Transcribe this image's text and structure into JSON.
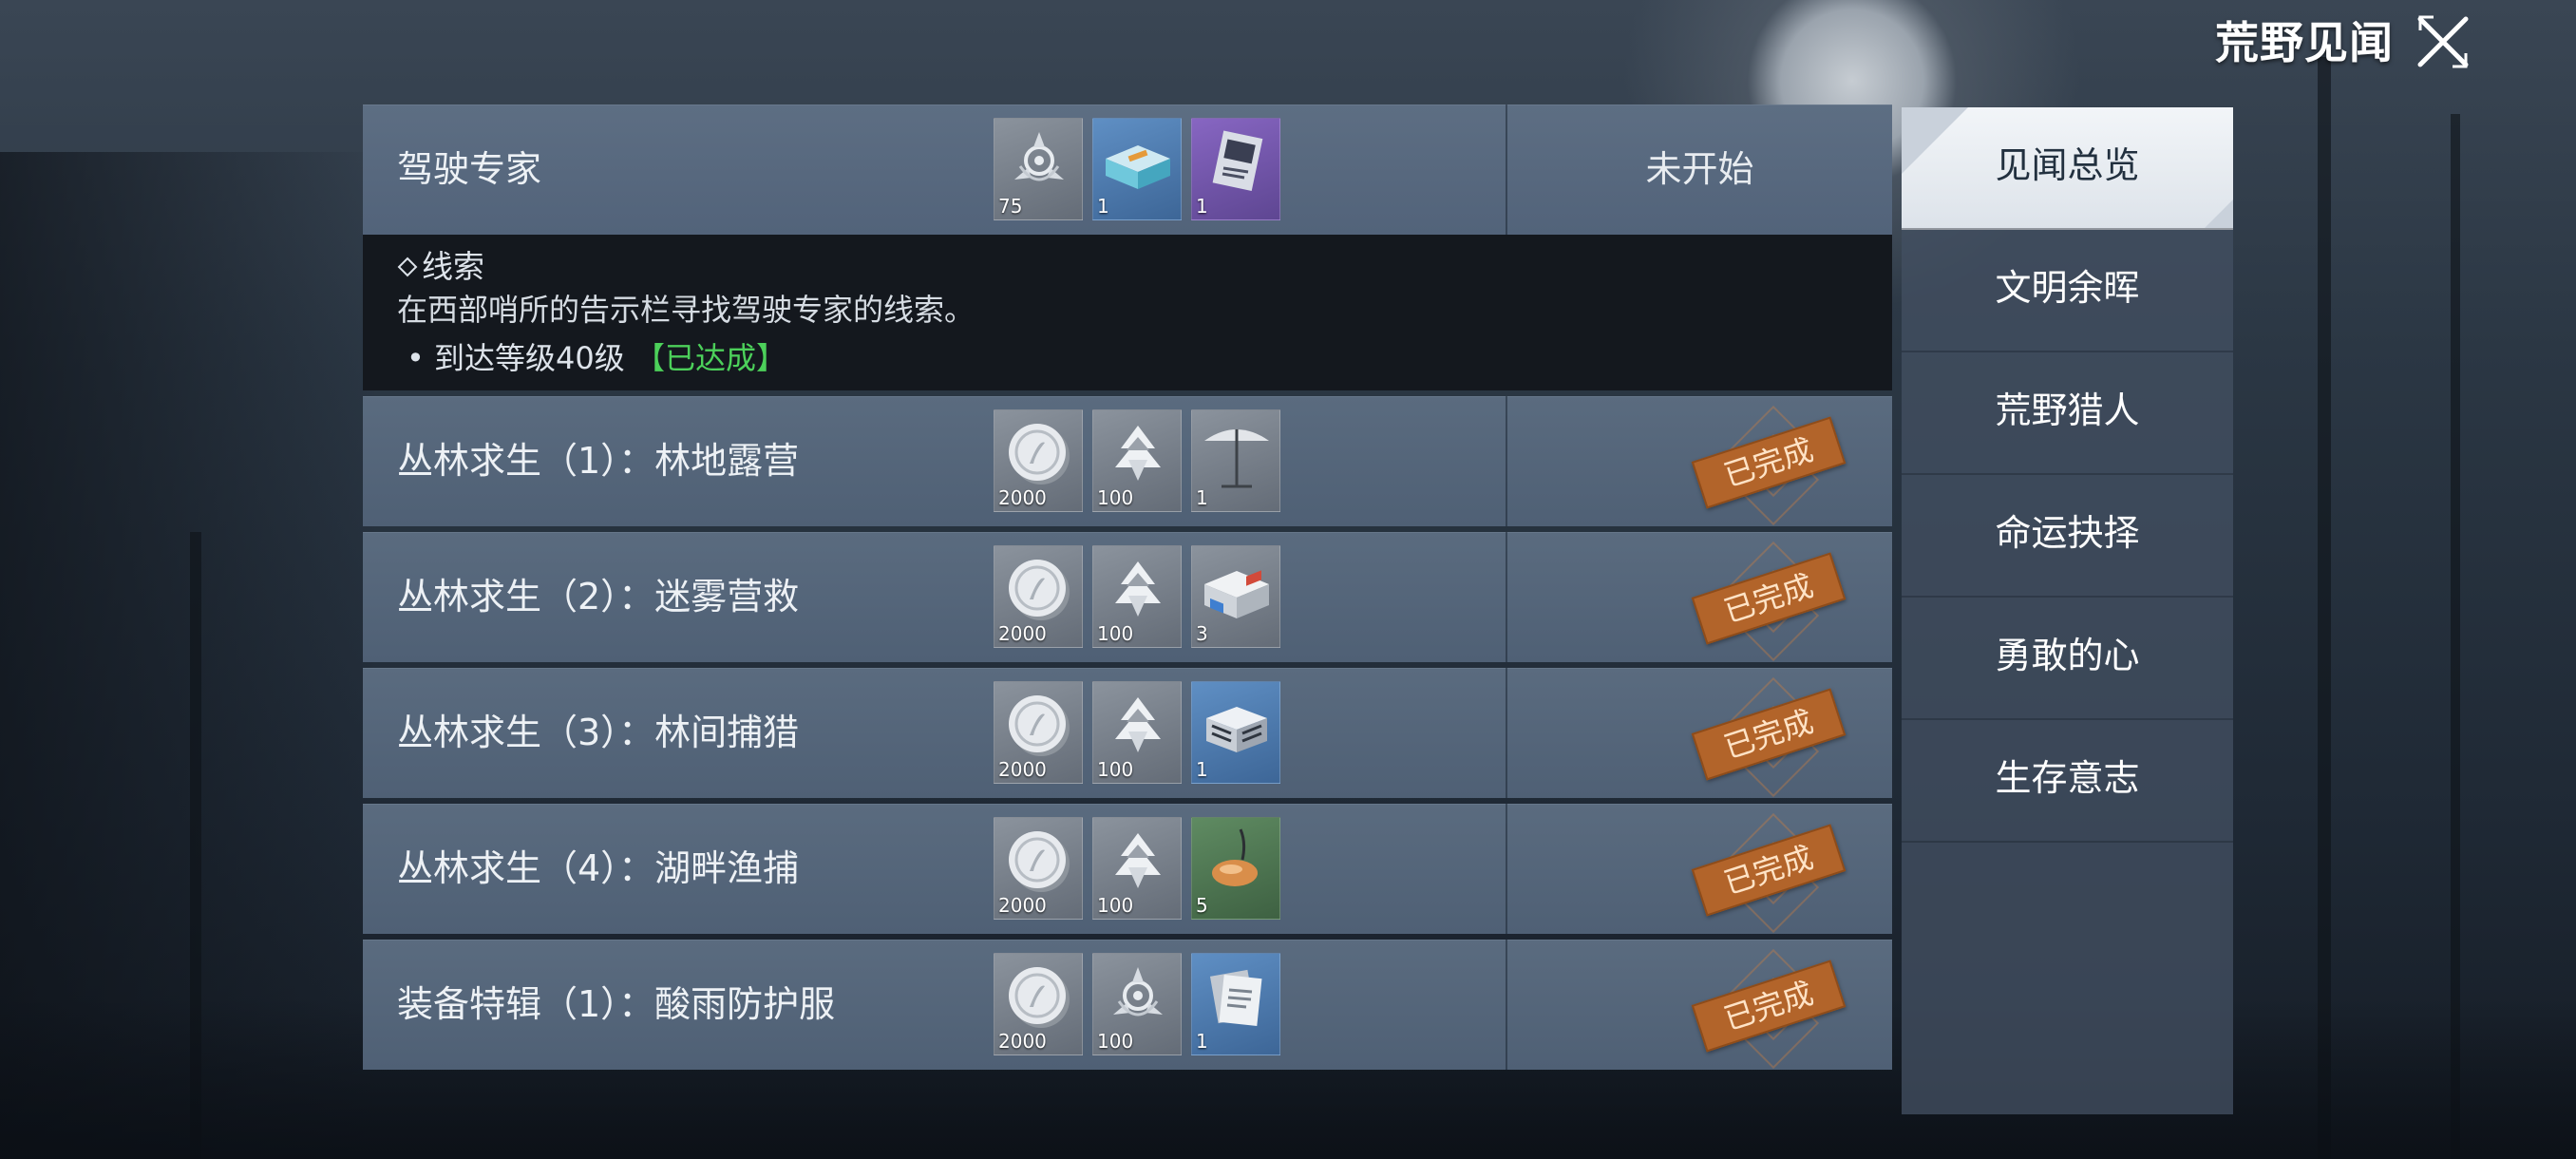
{
  "header": {
    "title": "荒野见闻",
    "close_icon": "close-icon"
  },
  "side_tabs": [
    {
      "label": "见闻总览",
      "active": true
    },
    {
      "label": "文明余晖",
      "active": false
    },
    {
      "label": "荒野猎人",
      "active": false
    },
    {
      "label": "命运抉择",
      "active": false
    },
    {
      "label": "勇敢的心",
      "active": false
    },
    {
      "label": "生存意志",
      "active": false
    }
  ],
  "quests": [
    {
      "name": "驾驶专家",
      "status": "未开始",
      "rewards": [
        {
          "icon": "emblem-icon",
          "count": "75",
          "rarity": "grey"
        },
        {
          "icon": "vehicle-crate-icon",
          "count": "1",
          "rarity": "blue"
        },
        {
          "icon": "blueprint-card-icon",
          "count": "1",
          "rarity": "purple"
        }
      ],
      "detail": {
        "heading": "线索",
        "description": "在西部哨所的告示栏寻找驾驶专家的线索。",
        "requirement": "到达等级40级",
        "requirement_status": "【已达成】"
      }
    },
    {
      "name": "丛林求生（1）：林地露营",
      "status": "已完成",
      "rewards": [
        {
          "icon": "silver-coin-icon",
          "count": "2000",
          "rarity": "grey"
        },
        {
          "icon": "experience-icon",
          "count": "100",
          "rarity": "grey"
        },
        {
          "icon": "parasol-icon",
          "count": "1",
          "rarity": "grey"
        }
      ]
    },
    {
      "name": "丛林求生（2）：迷雾营救",
      "status": "已完成",
      "rewards": [
        {
          "icon": "silver-coin-icon",
          "count": "2000",
          "rarity": "grey"
        },
        {
          "icon": "experience-icon",
          "count": "100",
          "rarity": "grey"
        },
        {
          "icon": "medkit-box-icon",
          "count": "3",
          "rarity": "grey"
        }
      ]
    },
    {
      "name": "丛林求生（3）：林间捕猎",
      "status": "已完成",
      "rewards": [
        {
          "icon": "silver-coin-icon",
          "count": "2000",
          "rarity": "grey"
        },
        {
          "icon": "experience-icon",
          "count": "100",
          "rarity": "grey"
        },
        {
          "icon": "supply-box-icon",
          "count": "1",
          "rarity": "blue"
        }
      ]
    },
    {
      "name": "丛林求生（4）：湖畔渔捕",
      "status": "已完成",
      "rewards": [
        {
          "icon": "silver-coin-icon",
          "count": "2000",
          "rarity": "grey"
        },
        {
          "icon": "experience-icon",
          "count": "100",
          "rarity": "grey"
        },
        {
          "icon": "fishing-lure-icon",
          "count": "5",
          "rarity": "green"
        }
      ]
    },
    {
      "name": "装备特辑（1）：酸雨防护服",
      "status": "已完成",
      "rewards": [
        {
          "icon": "silver-coin-icon",
          "count": "2000",
          "rarity": "grey"
        },
        {
          "icon": "emblem-icon",
          "count": "100",
          "rarity": "grey"
        },
        {
          "icon": "manual-pages-icon",
          "count": "1",
          "rarity": "blue"
        }
      ]
    }
  ],
  "colors": {
    "accent_done": "#4cd05a",
    "stamp": "#b2642a",
    "row": "#55667b"
  }
}
